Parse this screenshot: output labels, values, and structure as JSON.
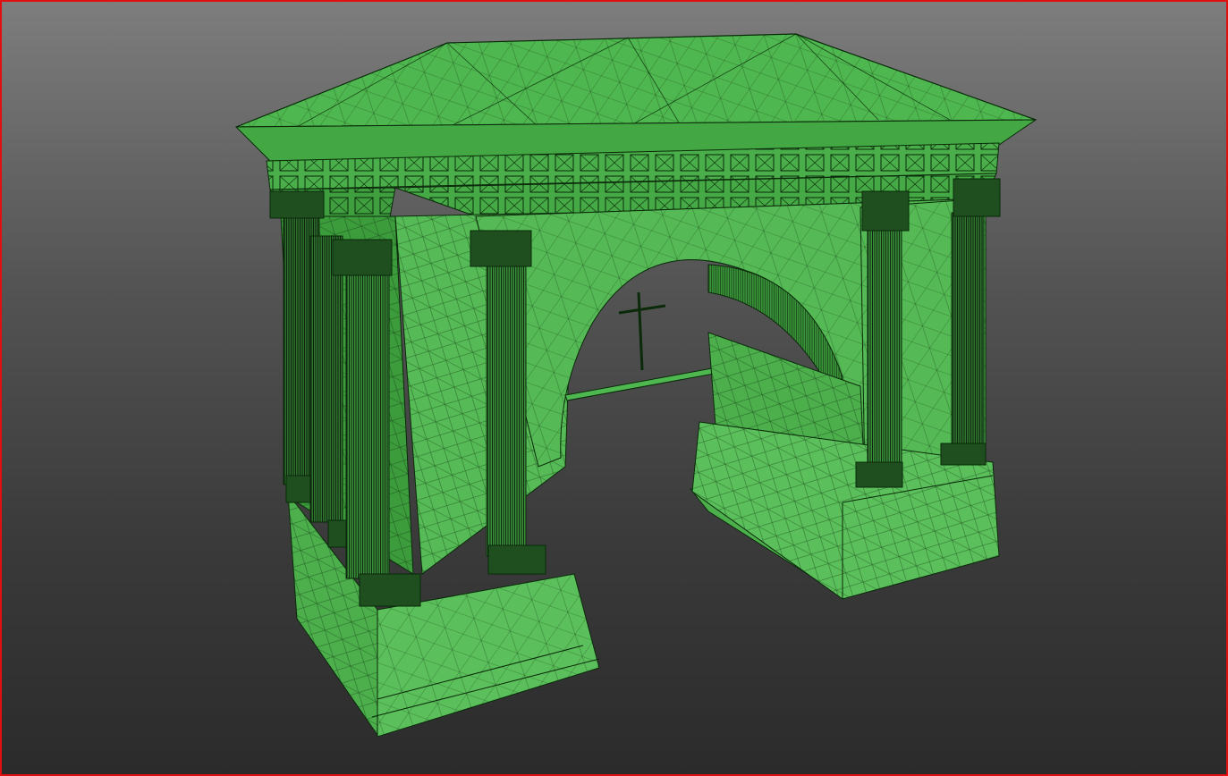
{
  "viewport": {
    "border_color": "#e01010",
    "background_top": "#7d7d7d",
    "background_bottom": "#2b2b2b"
  },
  "model": {
    "name": "triumphal-arch",
    "fill_color": "#4fb74f",
    "fill_light": "#62c862",
    "fill_dark": "#3a9a3a",
    "wire_color": "#0a2a0a"
  }
}
